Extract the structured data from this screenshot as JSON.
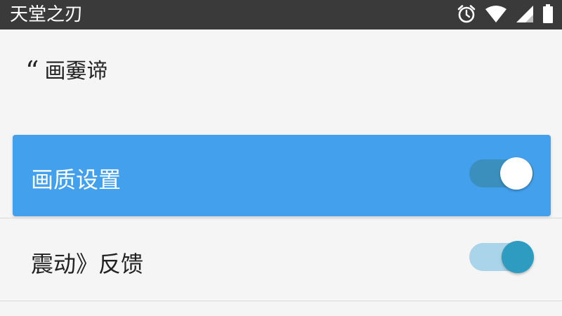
{
  "status_bar": {
    "app_title": "天堂之刃",
    "icons": [
      "alarm-clock-icon",
      "wifi-icon",
      "cell-signal-icon",
      "battery-icon"
    ],
    "background_color": "#3a3a3a"
  },
  "section": {
    "quote_glyph": "“",
    "title": "画嫑谛"
  },
  "settings": [
    {
      "label": "画质设置",
      "toggle_on": true,
      "highlighted": true,
      "highlight_color": "#42a0ed"
    },
    {
      "label": "震动》反馈",
      "toggle_on": true,
      "highlighted": false,
      "accent_color": "#2e9cc0"
    }
  ]
}
